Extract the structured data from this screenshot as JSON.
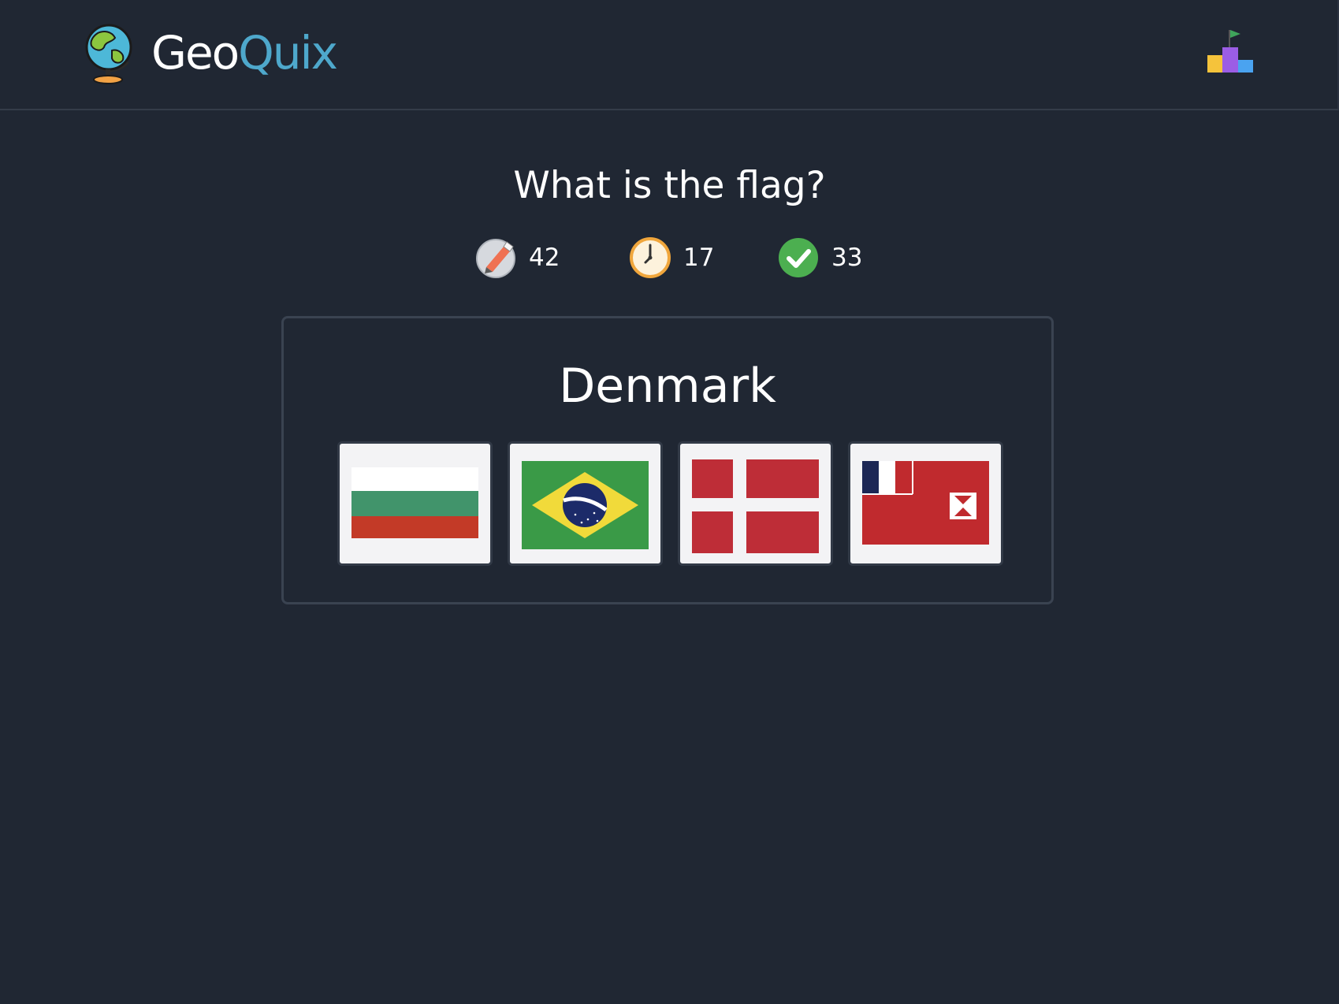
{
  "header": {
    "brand_part1": "Geo",
    "brand_part2": "Quix",
    "brand_accent_color": "#4ea8cc",
    "logo_icon": "globe-icon",
    "leaderboard_icon": "podium-leaderboard-icon"
  },
  "quiz": {
    "question": "What is the flag?",
    "country": "Denmark"
  },
  "stats": [
    {
      "icon": "compass-pencil-icon",
      "value": "42"
    },
    {
      "icon": "clock-icon",
      "value": "17"
    },
    {
      "icon": "check-circle-icon",
      "value": "33"
    }
  ],
  "options": [
    {
      "flag": "bulgaria-flag",
      "colors": [
        "#ffffff",
        "#41946b",
        "#c33a27"
      ]
    },
    {
      "flag": "brazil-flag",
      "colors": [
        "#3a9a47",
        "#f1da3a",
        "#1c2b69"
      ]
    },
    {
      "flag": "denmark-flag",
      "colors": [
        "#be2d37",
        "#ffffff"
      ]
    },
    {
      "flag": "wallis-and-futuna-flag",
      "colors": [
        "#c02a2e",
        "#ffffff",
        "#1c2755"
      ]
    }
  ],
  "colors": {
    "background": "#202733",
    "panel_border": "#3a4351",
    "option_background": "#f3f3f5"
  }
}
